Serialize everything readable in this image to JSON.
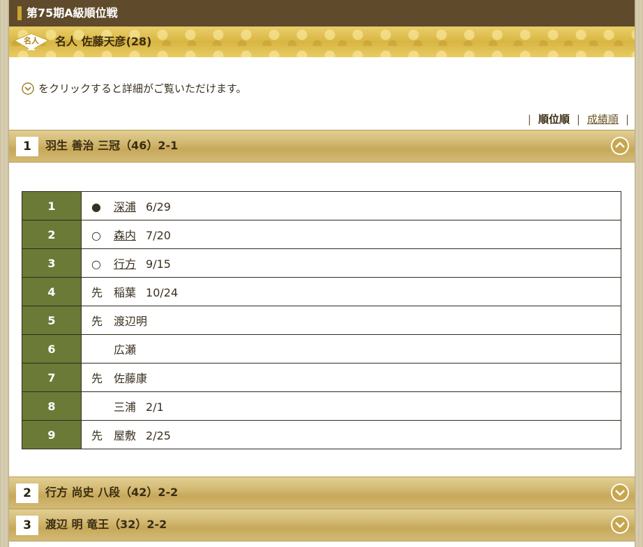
{
  "topbar": {
    "title": "第75期A級順位戦"
  },
  "banner": {
    "badge": "名人",
    "meijin": "名人 佐藤天彦(28)"
  },
  "hint": {
    "text": "をクリックすると詳細がご覧いただけます。",
    "icon": "chevron-down-circle-icon"
  },
  "sort": {
    "by_rank": "順位順",
    "by_record": "成績順",
    "sep": "|"
  },
  "players": [
    {
      "rank": "1",
      "name": "羽生 善治 三冠（46）2-1",
      "expanded": true,
      "toggle_icon": "chevron-up-circle-icon"
    },
    {
      "rank": "2",
      "name": "行方 尚史 八段（42）2-2",
      "expanded": false,
      "toggle_icon": "chevron-down-circle-icon"
    },
    {
      "rank": "3",
      "name": "渡辺 明 竜王（32）2-2",
      "expanded": false,
      "toggle_icon": "chevron-down-circle-icon"
    }
  ],
  "games": [
    {
      "round": "1",
      "mark": "●",
      "opponent": "深浦",
      "date": "6/29",
      "linked": true
    },
    {
      "round": "2",
      "mark": "○",
      "opponent": "森内",
      "date": "7/20",
      "linked": true
    },
    {
      "round": "3",
      "mark": "○",
      "opponent": "行方",
      "date": "9/15",
      "linked": true
    },
    {
      "round": "4",
      "mark": "先",
      "opponent": "稲葉",
      "date": "10/24",
      "linked": false
    },
    {
      "round": "5",
      "mark": "先",
      "opponent": "渡辺明",
      "date": "",
      "linked": false
    },
    {
      "round": "6",
      "mark": "",
      "opponent": "広瀬",
      "date": "",
      "linked": false
    },
    {
      "round": "7",
      "mark": "先",
      "opponent": "佐藤康",
      "date": "",
      "linked": false
    },
    {
      "round": "8",
      "mark": "",
      "opponent": "三浦",
      "date": "2/1",
      "linked": false
    },
    {
      "round": "9",
      "mark": "先",
      "opponent": "屋敷",
      "date": "2/25",
      "linked": false
    }
  ],
  "colors": {
    "topbar": "#5f4b2b",
    "accent_gold": "#d9b643",
    "round_cell": "#6b7a36"
  }
}
